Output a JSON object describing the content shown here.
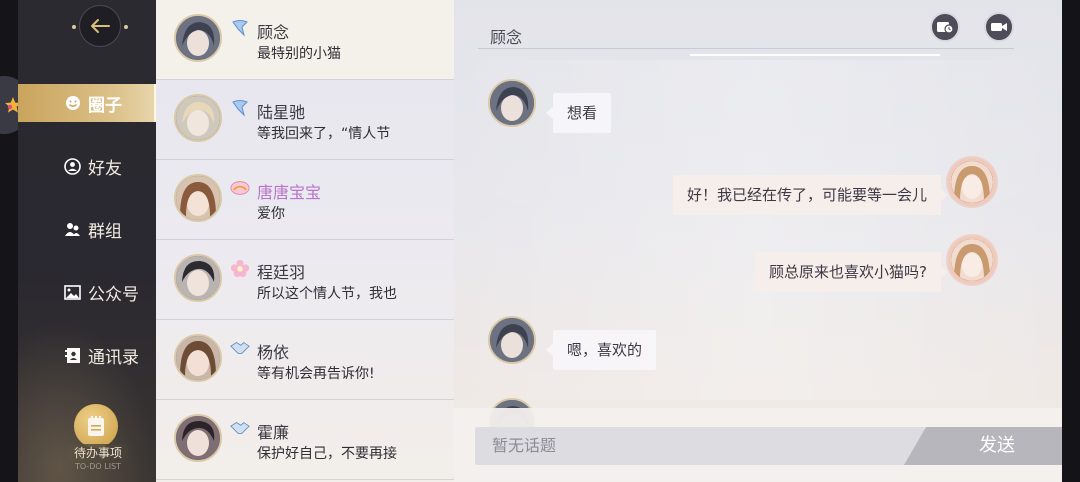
{
  "sidebar": {
    "back_label": "",
    "nav": [
      {
        "label": "圈子",
        "icon": "smile-icon",
        "active": true
      },
      {
        "label": "好友",
        "icon": "friend-icon",
        "active": false
      },
      {
        "label": "群组",
        "icon": "group-icon",
        "active": false
      },
      {
        "label": "公众号",
        "icon": "image-icon",
        "active": false
      },
      {
        "label": "通讯录",
        "icon": "contacts-icon",
        "active": false
      }
    ],
    "todo": {
      "label": "待办事项",
      "sub": "TO-DO LIST"
    }
  },
  "conversations": [
    {
      "name": "顾念",
      "preview": "最特别的小猫",
      "badge": "blue-crystal-icon",
      "selected": true
    },
    {
      "name": "陆星驰",
      "preview": "等我回来了，“情人节",
      "badge": "blue-crystal-icon",
      "selected": false
    },
    {
      "name": "唐唐宝宝",
      "preview": "爱你",
      "badge": "pink-ribbon-icon",
      "selected": false
    },
    {
      "name": "程廷羽",
      "preview": "所以这个情人节，我也",
      "badge": "pink-flower-icon",
      "selected": false
    },
    {
      "name": "杨依",
      "preview": "等有机会再告诉你!",
      "badge": "handshake-icon",
      "selected": false
    },
    {
      "name": "霍廉",
      "preview": "保护好自己，不要再接",
      "badge": "handshake-icon",
      "selected": false
    }
  ],
  "chat": {
    "title": "顾念",
    "messages": [
      {
        "side": "left",
        "text": "想看"
      },
      {
        "side": "right",
        "text": "好！我已经在传了，可能要等一会儿"
      },
      {
        "side": "right",
        "text": "顾总原来也喜欢小猫吗?"
      },
      {
        "side": "left",
        "text": "嗯，喜欢的"
      }
    ],
    "input_placeholder": "暂无话题",
    "send_label": "发送"
  },
  "colors": {
    "accent_gold": "#c9a45c",
    "name_pink": "#b774c9"
  }
}
